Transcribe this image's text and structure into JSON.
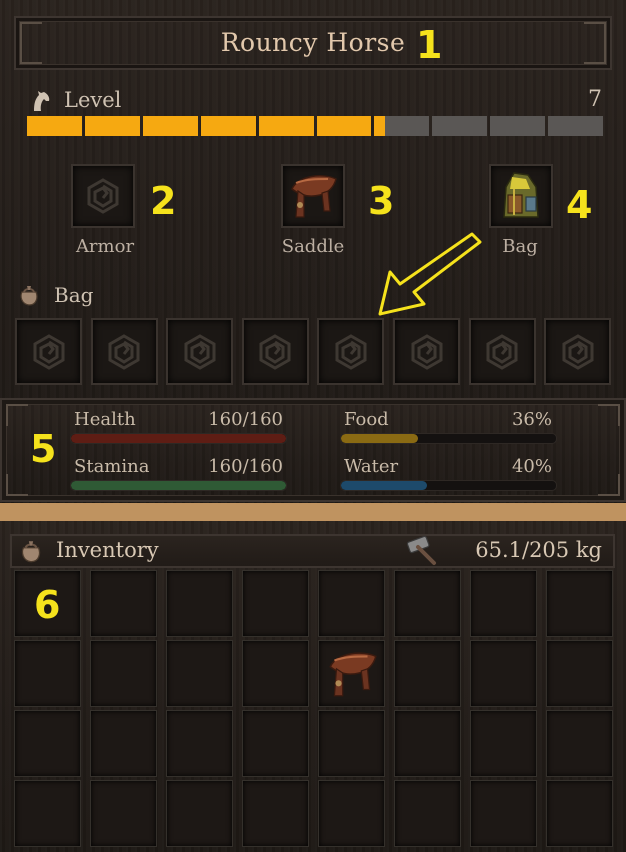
{
  "window": {
    "title": "Rouncy Horse"
  },
  "level": {
    "label": "Level",
    "value": "7",
    "segments_total": 10,
    "segments_filled": 6.2
  },
  "equipment": [
    {
      "label": "Armor",
      "marker": "2",
      "item": "empty"
    },
    {
      "label": "Saddle",
      "marker": "3",
      "item": "saddle-icon"
    },
    {
      "label": "Bag",
      "marker": "4",
      "item": "bag-icon"
    }
  ],
  "bag": {
    "label": "Bag",
    "slot_count": 8
  },
  "stats": {
    "health": {
      "label": "Health",
      "value": "160/160",
      "fraction": 1.0,
      "color": "#5e1d14"
    },
    "stamina": {
      "label": "Stamina",
      "value": "160/160",
      "fraction": 1.0,
      "color": "#2f5a35"
    },
    "food": {
      "label": "Food",
      "value": "36%",
      "fraction": 0.36,
      "color": "#8a6a13"
    },
    "water": {
      "label": "Water",
      "value": "40%",
      "fraction": 0.4,
      "color": "#1d4a6b"
    }
  },
  "inventory": {
    "title": "Inventory",
    "weight": "65.1/205 kg",
    "rows": 4,
    "cols": 8,
    "items": [
      {
        "row": 2,
        "col": 5,
        "icon": "saddle-icon"
      }
    ]
  },
  "markers": {
    "m1": "1",
    "m2": "2",
    "m3": "3",
    "m4": "4",
    "m5": "5",
    "m6": "6"
  },
  "colors": {
    "accent": "#f6a911",
    "marker": "#f5e21c",
    "panel_bg": "#241e1a",
    "border_gap": "#bf9360"
  }
}
